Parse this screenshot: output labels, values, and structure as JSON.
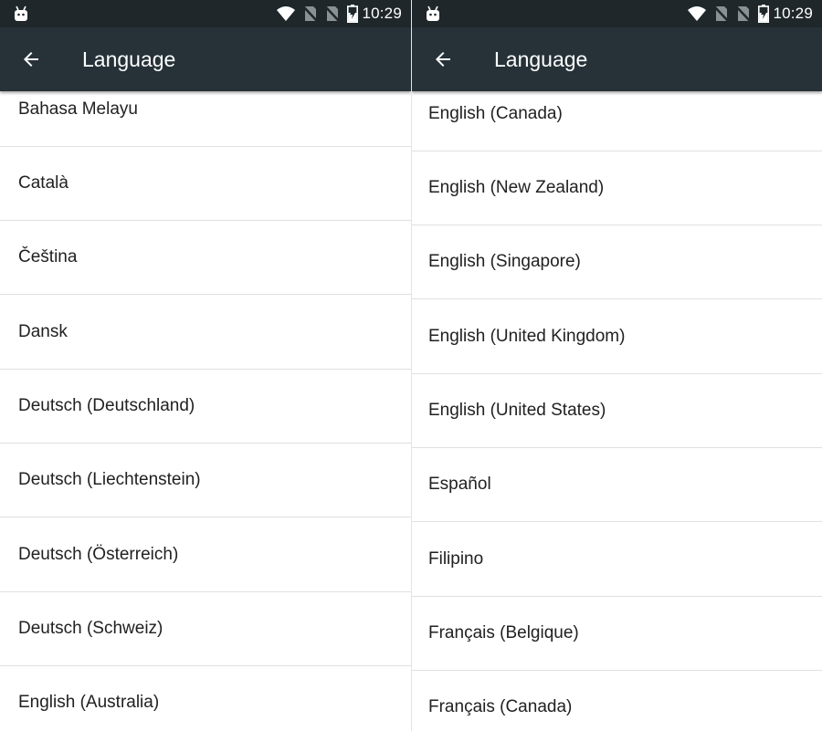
{
  "status_bar": {
    "time": "10:29",
    "icons": [
      "android-bot-icon",
      "wifi-icon",
      "no-sim-icon",
      "no-sim-icon",
      "battery-charging-icon"
    ]
  },
  "app_bar": {
    "title": "Language",
    "back_icon": "arrow-back-icon",
    "background": "#263238"
  },
  "left_list": {
    "items": [
      {
        "label": "Bahasa Melayu"
      },
      {
        "label": "Català"
      },
      {
        "label": "Čeština"
      },
      {
        "label": "Dansk"
      },
      {
        "label": "Deutsch (Deutschland)"
      },
      {
        "label": "Deutsch (Liechtenstein)"
      },
      {
        "label": "Deutsch (Österreich)"
      },
      {
        "label": "Deutsch (Schweiz)"
      },
      {
        "label": "English (Australia)"
      }
    ]
  },
  "right_list": {
    "items": [
      {
        "label": "English (Canada)"
      },
      {
        "label": "English (New Zealand)"
      },
      {
        "label": "English (Singapore)"
      },
      {
        "label": "English (United Kingdom)"
      },
      {
        "label": "English (United States)"
      },
      {
        "label": "Español"
      },
      {
        "label": "Filipino"
      },
      {
        "label": "Français (Belgique)"
      },
      {
        "label": "Français (Canada)"
      }
    ]
  }
}
